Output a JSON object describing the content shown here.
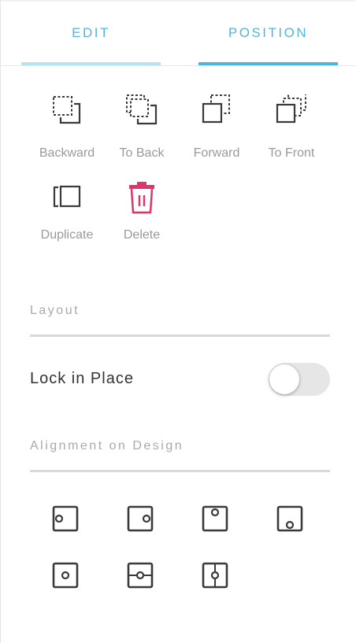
{
  "tabs": {
    "edit_label": "EDIT",
    "position_label": "POSITION",
    "active": "position"
  },
  "actions": {
    "backward_label": "Backward",
    "to_back_label": "To Back",
    "forward_label": "Forward",
    "to_front_label": "To Front",
    "duplicate_label": "Duplicate",
    "delete_label": "Delete"
  },
  "layout": {
    "section_label": "Layout",
    "lock_label": "Lock in Place",
    "lock_enabled": false
  },
  "alignment": {
    "section_label": "Alignment on Design",
    "options": [
      "align-left",
      "align-right",
      "align-top",
      "align-bottom",
      "align-center",
      "align-middle-horizontal",
      "align-middle-vertical"
    ]
  },
  "colors": {
    "accent": "#4fb7de",
    "accent_light": "#b5e3ef",
    "delete": "#e0356b",
    "icon": "#3a3a3a",
    "muted_text": "#9a9a9a"
  },
  "icons": {
    "backward": "send-backward-icon",
    "to_back": "send-to-back-icon",
    "forward": "bring-forward-icon",
    "to_front": "bring-to-front-icon",
    "duplicate": "duplicate-icon",
    "delete": "trash-icon"
  }
}
